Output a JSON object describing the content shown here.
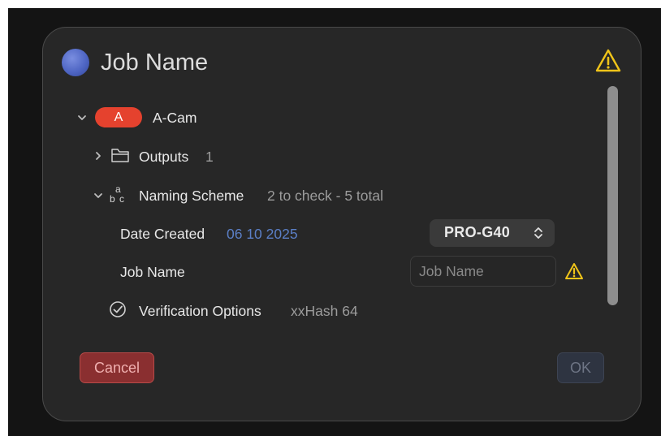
{
  "dialog": {
    "title": "Job Name",
    "title_icon": "blue-circle-icon",
    "warning_icon": "warning-triangle-icon"
  },
  "tree": {
    "camera": {
      "badge": "A",
      "label": "A-Cam",
      "badge_color": "#e5422e",
      "expanded": true
    },
    "outputs": {
      "label": "Outputs",
      "count": "1",
      "expanded": false
    },
    "naming_scheme": {
      "label": "Naming Scheme",
      "detail": "2 to check - 5 total",
      "expanded": true
    },
    "date_created": {
      "label": "Date Created",
      "value": "06 10 2025",
      "select_value": "PRO-G40"
    },
    "job_name": {
      "label": "Job Name",
      "input_value": "",
      "input_placeholder": "Job Name"
    },
    "verification": {
      "label": "Verification Options",
      "value": "xxHash 64"
    }
  },
  "buttons": {
    "cancel": "Cancel",
    "ok": "OK"
  },
  "colors": {
    "accent_blue": "#5b7fc6",
    "warning": "#f0c419",
    "cancel_bg": "#8a2f30"
  }
}
